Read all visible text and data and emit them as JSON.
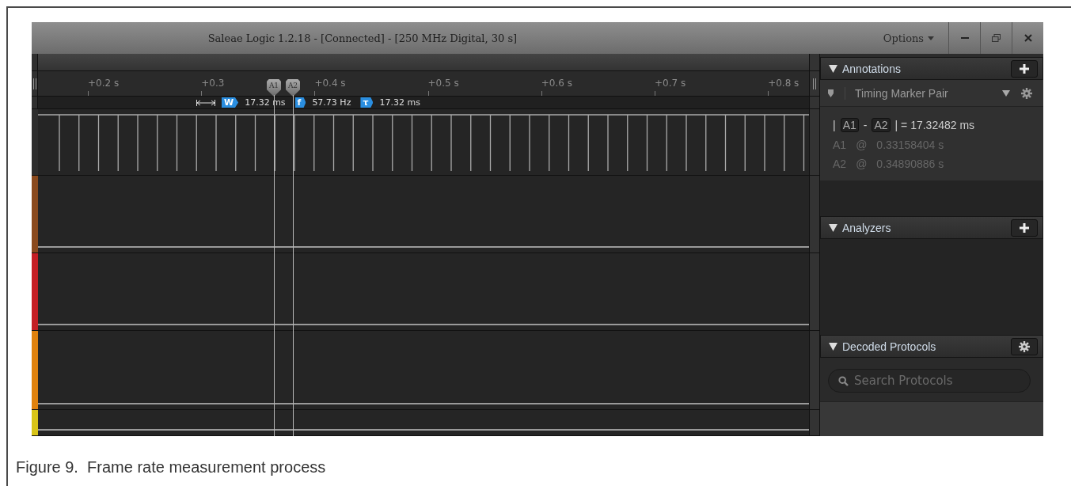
{
  "window": {
    "title": "Saleae Logic 1.2.18 - [Connected] - [250 MHz Digital, 30 s]",
    "menu": "Options"
  },
  "ruler": {
    "ticks": [
      "+0.2 s",
      "+0.3",
      "+0.4 s",
      "+0.5 s",
      "+0.6 s",
      "+0.7 s",
      "+0.8 s"
    ]
  },
  "markers": [
    {
      "label": "A1"
    },
    {
      "label": "A2"
    }
  ],
  "measurements": [
    {
      "badge": "W",
      "value": "17.32 ms"
    },
    {
      "badge": "f",
      "value": "57.73 Hz"
    },
    {
      "badge": "τ",
      "value": "17.32 ms"
    }
  ],
  "channels": [
    {
      "kind": "pulses",
      "color": "#2e2e2e"
    },
    {
      "kind": "flat",
      "color": "#8a4a1e"
    },
    {
      "kind": "flat",
      "color": "#c41e24"
    },
    {
      "kind": "flat",
      "color": "#e0820e"
    },
    {
      "kind": "flat",
      "color": "#d8c418"
    }
  ],
  "annotations": {
    "title": "Annotations",
    "item": "Timing Marker Pair",
    "delta": [
      {
        "text": "|",
        "boxed": false
      },
      {
        "text": "A1",
        "boxed": true
      },
      {
        "text": "-",
        "boxed": false
      },
      {
        "text": "A2",
        "boxed": true
      },
      {
        "text": "| = 17.32482 ms",
        "boxed": false
      }
    ],
    "positions": [
      {
        "marker": "A1",
        "at": "@",
        "time": "0.33158404 s"
      },
      {
        "marker": "A2",
        "at": "@",
        "time": "0.34890886 s"
      }
    ]
  },
  "analyzers": {
    "title": "Analyzers"
  },
  "decoded_protocols": {
    "title": "Decoded Protocols",
    "search": {
      "placeholder": "Search Protocols"
    }
  },
  "caption": "Figure 9.  Frame rate measurement process"
}
